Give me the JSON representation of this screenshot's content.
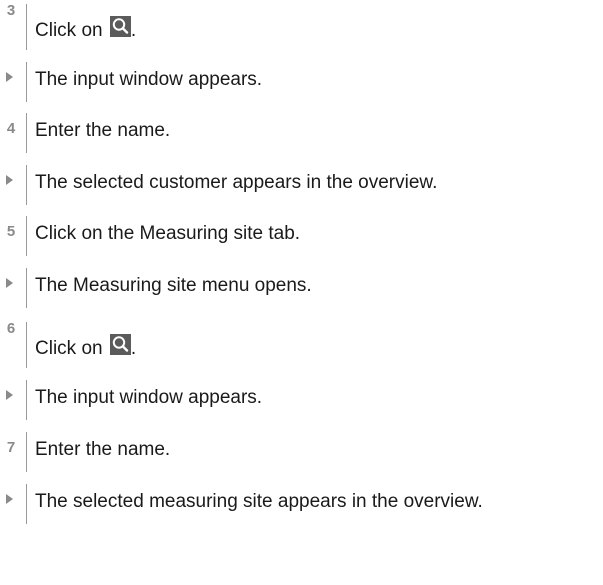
{
  "steps": [
    {
      "kind": "step",
      "number": "3",
      "before": "Click on",
      "icon": "search-icon",
      "after": "."
    },
    {
      "kind": "result",
      "text": "The input window appears."
    },
    {
      "kind": "step",
      "number": "4",
      "text": "Enter the name."
    },
    {
      "kind": "result",
      "text": "The selected customer appears in the overview."
    },
    {
      "kind": "step",
      "number": "5",
      "text": "Click on the Measuring site tab."
    },
    {
      "kind": "result",
      "text": "The Measuring site menu opens."
    },
    {
      "kind": "step",
      "number": "6",
      "before": "Click on",
      "icon": "search-icon",
      "after": "."
    },
    {
      "kind": "result",
      "text": "The input window appears."
    },
    {
      "kind": "step",
      "number": "7",
      "text": "Enter the name."
    },
    {
      "kind": "result",
      "text": "The selected measuring site appears in the overview."
    }
  ],
  "colors": {
    "marker": "#8a8a8a",
    "icon_bg": "#5b5b5b",
    "text": "#1a1a1a"
  }
}
